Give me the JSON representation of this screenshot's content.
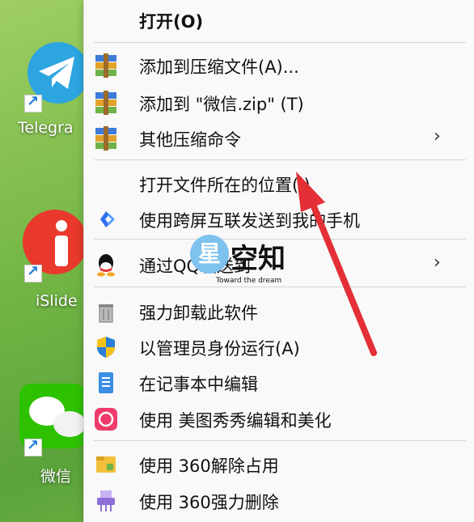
{
  "desktop": {
    "icons": [
      {
        "label": "Telegra"
      },
      {
        "label": "iSlide"
      },
      {
        "label": "微信"
      }
    ]
  },
  "menu": {
    "items": [
      {
        "label": "打开(O)",
        "icon": "none"
      },
      {
        "label": "添加到压缩文件(A)...",
        "icon": "winrar-icon"
      },
      {
        "label": "添加到 \"微信.zip\" (T)",
        "icon": "winrar-icon"
      },
      {
        "label": "其他压缩命令",
        "icon": "winrar-icon",
        "submenu": true
      },
      {
        "label": "打开文件所在的位置(I)",
        "icon": "none"
      },
      {
        "label": "使用跨屏互联发送到我的手机",
        "icon": "cross-screen-icon"
      },
      {
        "label": "通过QQ发送到",
        "icon": "qq-icon",
        "submenu": true
      },
      {
        "label": "强力卸载此软件",
        "icon": "trash-icon"
      },
      {
        "label": "以管理员身份运行(A)",
        "icon": "shield-icon"
      },
      {
        "label": "在记事本中编辑",
        "icon": "notepad-icon"
      },
      {
        "label": "使用 美图秀秀编辑和美化",
        "icon": "meitu-icon"
      },
      {
        "label": "使用 360解除占用",
        "icon": "unlock-360-icon"
      },
      {
        "label": "使用 360强力删除",
        "icon": "shredder-360-icon"
      }
    ],
    "chevron": "›"
  },
  "watermark": {
    "star": "星",
    "text": "空知",
    "tagline": "Toward the dream"
  },
  "colors": {
    "arrow": "#e32f35",
    "menu_bg": "#f9f9f9",
    "desktop": "#75b746"
  }
}
